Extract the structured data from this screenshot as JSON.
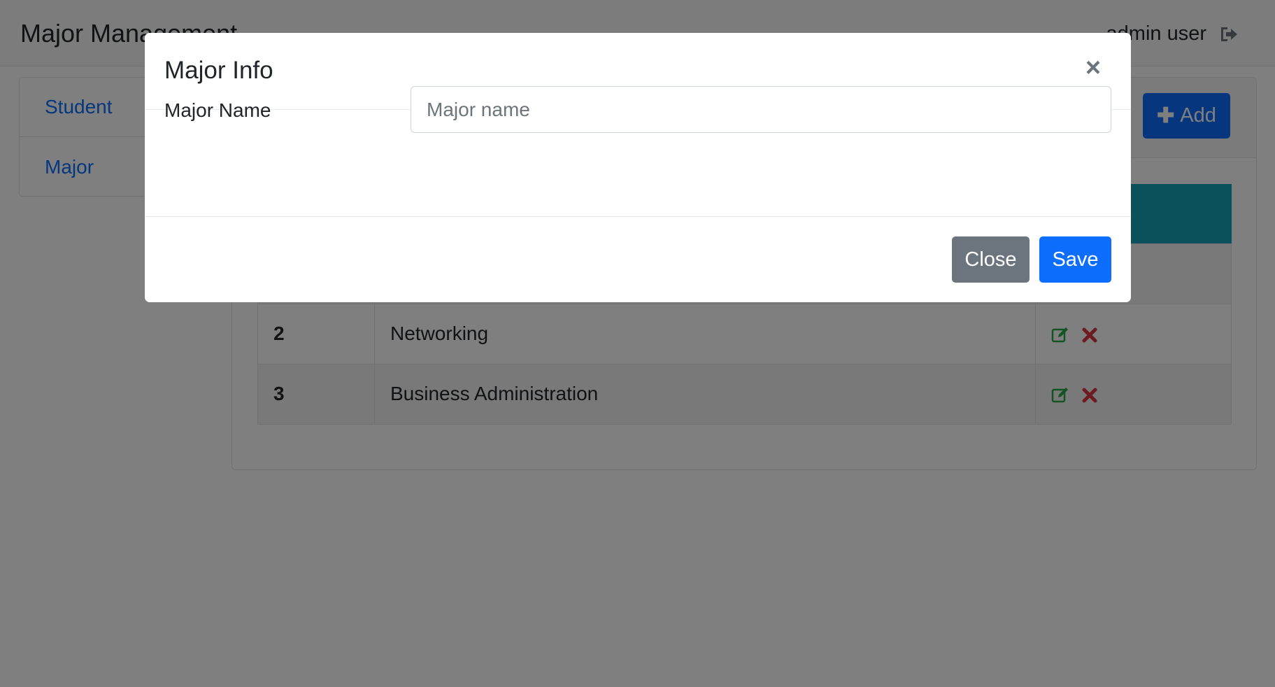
{
  "header": {
    "title": "Major Management",
    "user": "admin user",
    "logout_icon": "sign-out-icon"
  },
  "sidebar": {
    "items": [
      {
        "label": "Student"
      },
      {
        "label": "Major"
      }
    ]
  },
  "toolbar": {
    "add_label": "Add",
    "add_icon": "plus-icon"
  },
  "table": {
    "rows": [
      {
        "id": "2",
        "name": "Networking"
      },
      {
        "id": "3",
        "name": "Business Administration"
      }
    ],
    "edit_icon": "edit-icon",
    "delete_icon": "delete-icon"
  },
  "modal": {
    "title": "Major Info",
    "close_icon": "close-icon",
    "field_label": "Major Name",
    "field_placeholder": "Major name",
    "field_value": "",
    "close_label": "Close",
    "save_label": "Save"
  },
  "colors": {
    "primary": "#0d6efd",
    "secondary": "#6c757d",
    "table_header": "#17a2b8",
    "edit": "#28a745",
    "delete": "#dc3545",
    "backdrop": "rgba(0,0,0,0.5)"
  }
}
